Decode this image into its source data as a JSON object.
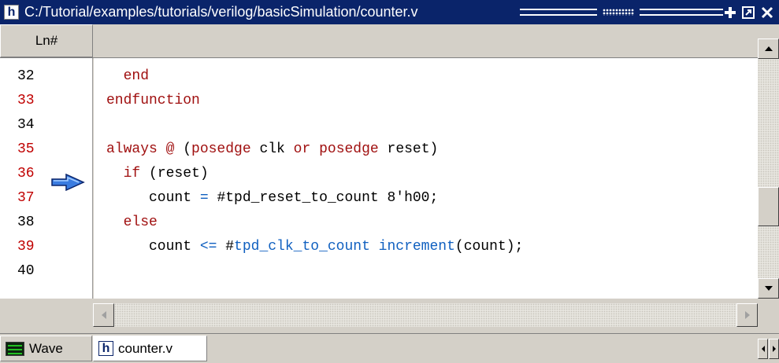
{
  "window": {
    "title": "C:/Tutorial/examples/tutorials/verilog/basicSimulation/counter.v",
    "app_icon_letter": "h",
    "buttons": [
      "plus-icon",
      "undock-icon",
      "close-icon"
    ]
  },
  "editor": {
    "ln_header": "Ln#",
    "breakpoint_capable_color": "#c00000",
    "plain_color": "#000000",
    "current_line": "36",
    "lines": [
      {
        "num": "32",
        "executable": false,
        "segments": [
          [
            "kw",
            "  end"
          ]
        ]
      },
      {
        "num": "33",
        "executable": true,
        "segments": [
          [
            "kw",
            "endfunction"
          ]
        ]
      },
      {
        "num": "34",
        "executable": false,
        "segments": []
      },
      {
        "num": "35",
        "executable": true,
        "segments": [
          [
            "kw",
            "always @ "
          ],
          [
            "plain",
            "("
          ],
          [
            "kw",
            "posedge"
          ],
          [
            "plain",
            " clk "
          ],
          [
            "kw",
            "or"
          ],
          [
            "plain",
            " "
          ],
          [
            "kw",
            "posedge"
          ],
          [
            "plain",
            " reset)"
          ]
        ]
      },
      {
        "num": "36",
        "executable": true,
        "segments": [
          [
            "kw",
            "  if"
          ],
          [
            "plain",
            " (reset)"
          ]
        ]
      },
      {
        "num": "37",
        "executable": true,
        "segments": [
          [
            "plain",
            "     count "
          ],
          [
            "sig",
            "="
          ],
          [
            "plain",
            " #tpd_reset_to_count 8'h00;"
          ]
        ]
      },
      {
        "num": "38",
        "executable": false,
        "segments": [
          [
            "kw",
            "  else"
          ]
        ]
      },
      {
        "num": "39",
        "executable": true,
        "segments": [
          [
            "plain",
            "     count "
          ],
          [
            "sig",
            "<="
          ],
          [
            "plain",
            " #"
          ],
          [
            "sig",
            "tpd_clk_to_count increment"
          ],
          [
            "plain",
            "(count);"
          ]
        ]
      },
      {
        "num": "40",
        "executable": false,
        "segments": []
      }
    ]
  },
  "tabs": [
    {
      "label": "Wave",
      "icon": "wave-icon",
      "active": false
    },
    {
      "label": "counter.v",
      "icon": "verilog-file-icon",
      "active": true
    }
  ],
  "colors": {
    "titlebar": "#0a246a",
    "keyword": "#a01010",
    "signal": "#1060c0",
    "chrome": "#d4d0c8"
  }
}
